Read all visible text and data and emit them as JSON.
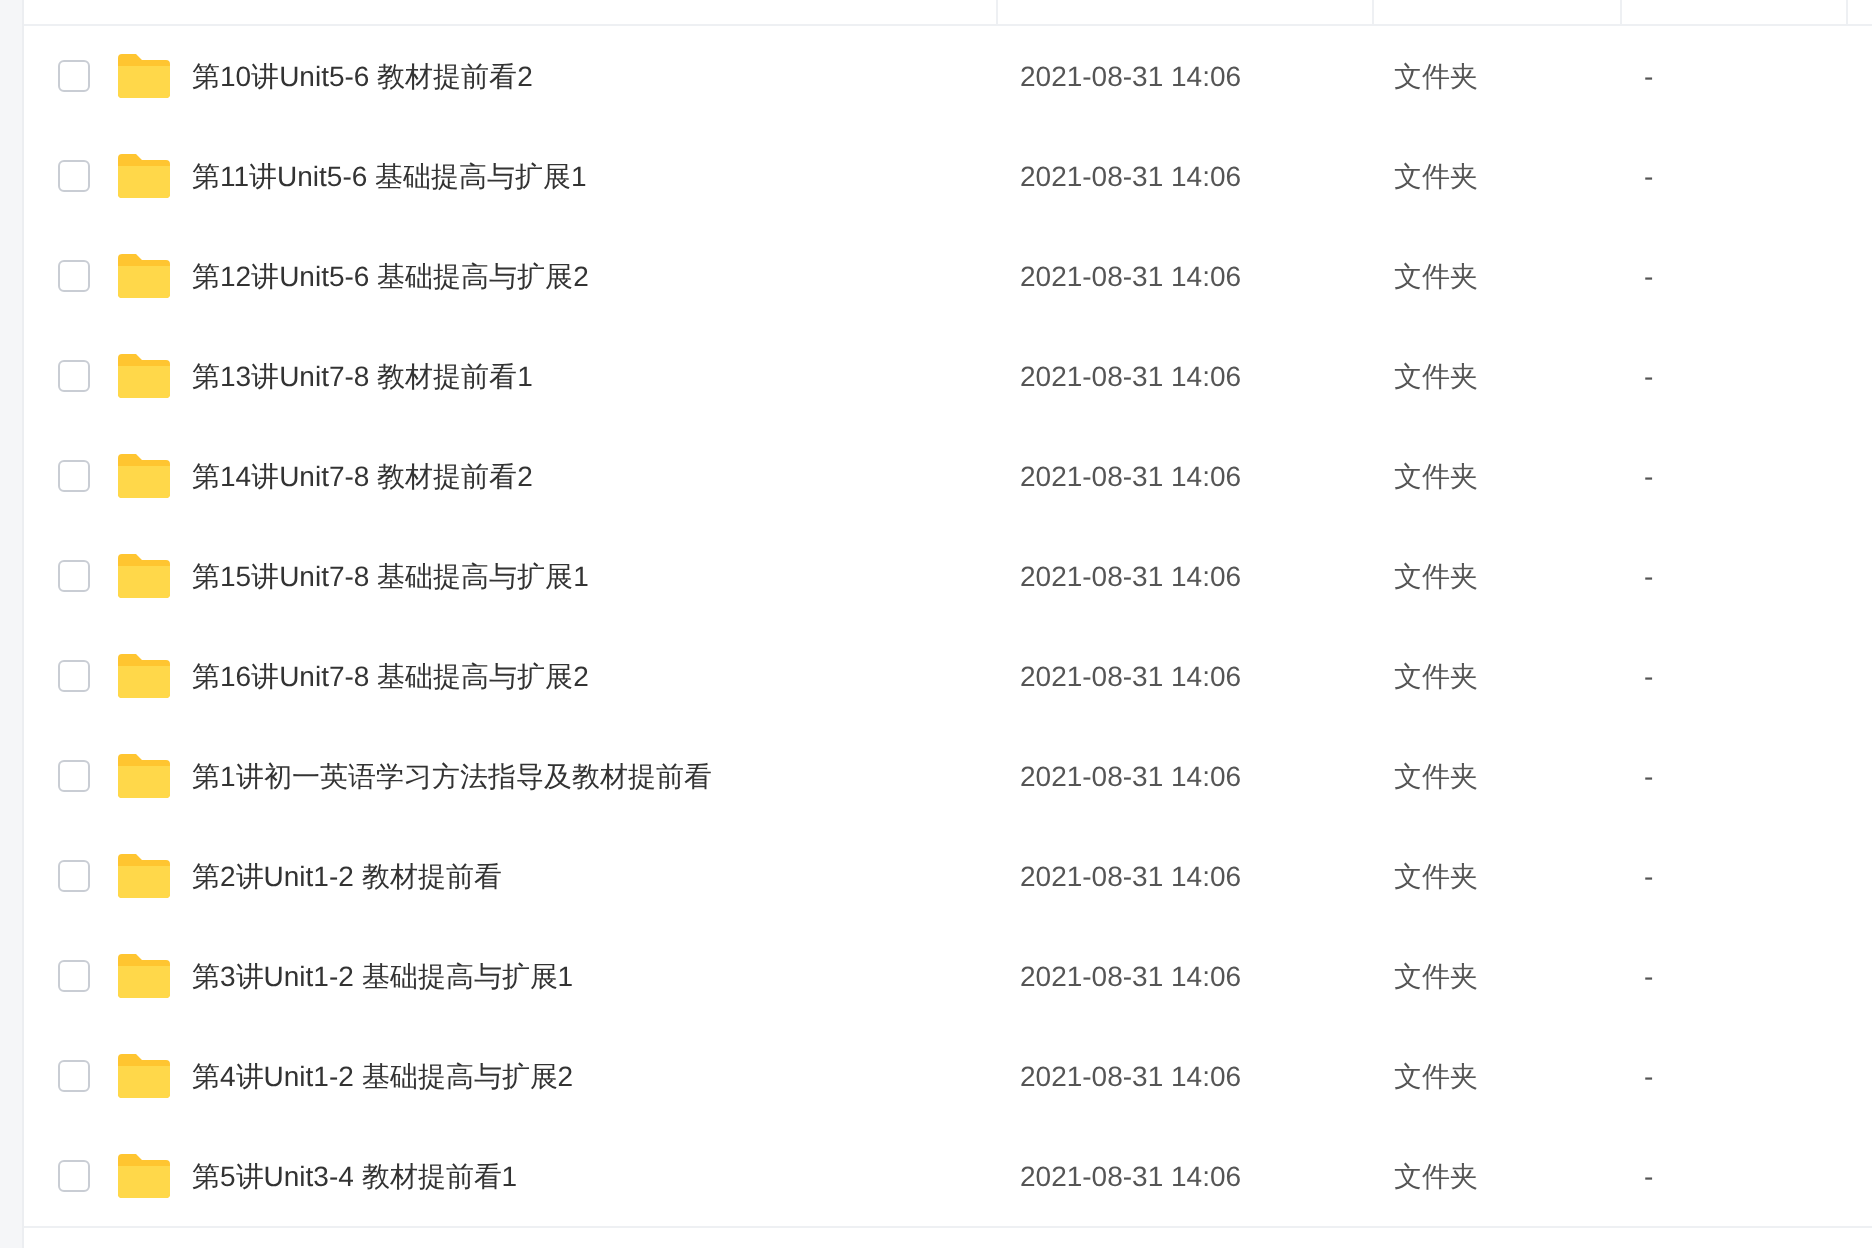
{
  "files": [
    {
      "name": "第10讲Unit5-6 教材提前看2",
      "modified": "2021-08-31 14:06",
      "type": "文件夹",
      "size": "-",
      "checked": false
    },
    {
      "name": "第11讲Unit5-6 基础提高与扩展1",
      "modified": "2021-08-31 14:06",
      "type": "文件夹",
      "size": "-",
      "checked": false
    },
    {
      "name": "第12讲Unit5-6 基础提高与扩展2",
      "modified": "2021-08-31 14:06",
      "type": "文件夹",
      "size": "-",
      "checked": false
    },
    {
      "name": "第13讲Unit7-8 教材提前看1",
      "modified": "2021-08-31 14:06",
      "type": "文件夹",
      "size": "-",
      "checked": false
    },
    {
      "name": "第14讲Unit7-8 教材提前看2",
      "modified": "2021-08-31 14:06",
      "type": "文件夹",
      "size": "-",
      "checked": false
    },
    {
      "name": "第15讲Unit7-8 基础提高与扩展1",
      "modified": "2021-08-31 14:06",
      "type": "文件夹",
      "size": "-",
      "checked": false
    },
    {
      "name": "第16讲Unit7-8 基础提高与扩展2",
      "modified": "2021-08-31 14:06",
      "type": "文件夹",
      "size": "-",
      "checked": false
    },
    {
      "name": "第1讲初一英语学习方法指导及教材提前看",
      "modified": "2021-08-31 14:06",
      "type": "文件夹",
      "size": "-",
      "checked": false
    },
    {
      "name": "第2讲Unit1-2 教材提前看",
      "modified": "2021-08-31 14:06",
      "type": "文件夹",
      "size": "-",
      "checked": false
    },
    {
      "name": "第3讲Unit1-2 基础提高与扩展1",
      "modified": "2021-08-31 14:06",
      "type": "文件夹",
      "size": "-",
      "checked": false
    },
    {
      "name": "第4讲Unit1-2 基础提高与扩展2",
      "modified": "2021-08-31 14:06",
      "type": "文件夹",
      "size": "-",
      "checked": false
    },
    {
      "name": "第5讲Unit3-4 教材提前看1",
      "modified": "2021-08-31 14:06",
      "type": "文件夹",
      "size": "-",
      "checked": false
    }
  ]
}
